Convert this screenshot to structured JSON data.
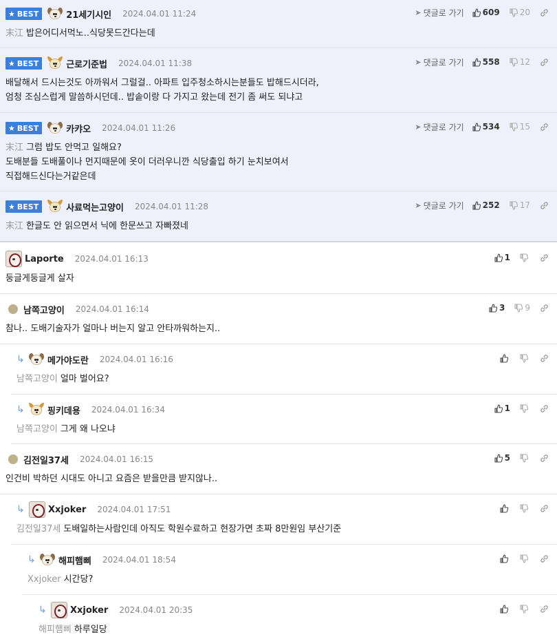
{
  "best_label": "BEST",
  "reply_link_label": "댓글로 가기",
  "comments": [
    {
      "nick": "21세기시인",
      "date": "2024.04.01 11:24",
      "mention": "末江",
      "lines": [
        "밥은어디서먹노..식당못드간다는데"
      ],
      "up": "609",
      "down": "20"
    },
    {
      "nick": "근로기준법",
      "date": "2024.04.01 11:38",
      "lines": [
        "배달해서 드시는것도 아까워서 그럴걸.. 아파트 입주청소하시는분들도 밥해드시더라,",
        "엄청 조심스럽게 말씀하시던데.. 밥솥이랑 다 가지고 왔는데 전기 좀 써도 되냐고"
      ],
      "up": "558",
      "down": "12"
    },
    {
      "nick": "카캬오",
      "date": "2024.04.01 11:26",
      "mention": "末江",
      "lines": [
        "그럼 밥도 안먹고 일해요?",
        "도배분들 도배풀이나 먼지때문에 옷이 더러우니깐 식당출입 하기 눈치보여서",
        "직접해드신다는거같은데"
      ],
      "up": "534",
      "down": "15"
    },
    {
      "nick": "사료먹는고양이",
      "date": "2024.04.01 11:28",
      "mention": "末江",
      "lines": [
        "한글도 안 읽으면서 닉에 한문쓰고 자빠졌네"
      ],
      "up": "252",
      "down": "17"
    },
    {
      "nick": "Laporte",
      "date": "2024.04.01 16:13",
      "lines": [
        "둥글게둥글게 살자"
      ],
      "up": "1",
      "down": ""
    },
    {
      "nick": "남쪽고양이",
      "date": "2024.04.01 16:14",
      "lines": [
        "참나.. 도배기술자가 얼마나 버는지 알고 안타까워하는지.."
      ],
      "up": "3",
      "down": "9"
    },
    {
      "nick": "메가야도란",
      "date": "2024.04.01 16:16",
      "mention": "남쪽고양이",
      "lines": [
        "얼마 벌어요?"
      ],
      "up": "",
      "down": ""
    },
    {
      "nick": "핑키데용",
      "date": "2024.04.01 16:34",
      "mention": "남쪽고양이",
      "lines": [
        "그게 왜 나오냐"
      ],
      "up": "1",
      "down": ""
    },
    {
      "nick": "김전일37세",
      "date": "2024.04.01 16:15",
      "lines": [
        "인건비 박하던 시대도 아니고 요즘은 받을만큼 받지않나.."
      ],
      "up": "5",
      "down": ""
    },
    {
      "nick": "Xxjoker",
      "date": "2024.04.01 17:51",
      "mention": "김전일37세",
      "lines": [
        "도배일하는사람인데 아직도 학원수료하고 현장가면 초짜 8만원임 부산기준"
      ],
      "up": "",
      "down": ""
    },
    {
      "nick": "해피햄삐",
      "date": "2024.04.01 18:54",
      "mention": "Xxjoker",
      "lines": [
        "시간당?"
      ],
      "up": "",
      "down": ""
    },
    {
      "nick": "Xxjoker",
      "date": "2024.04.01 20:35",
      "mention": "해피햄삐",
      "lines": [
        "하루일당"
      ],
      "up": "",
      "down": ""
    }
  ]
}
